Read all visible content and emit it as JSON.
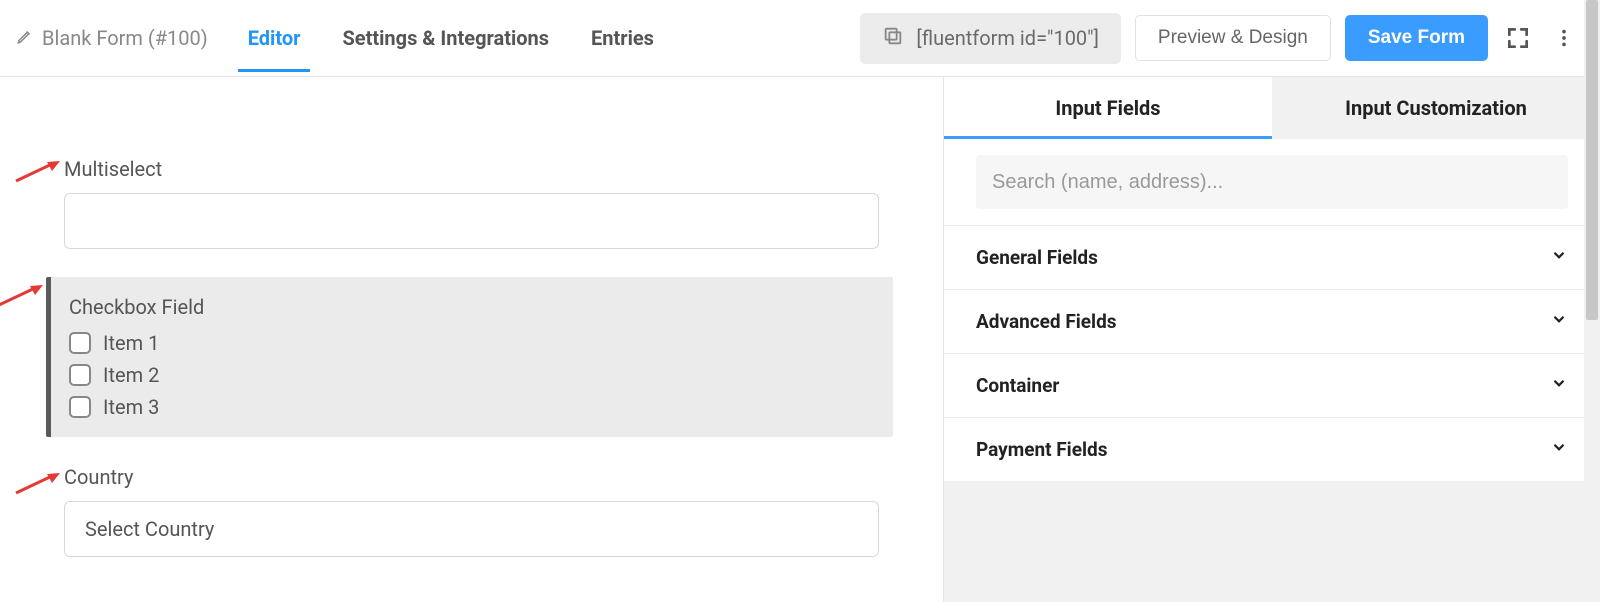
{
  "header": {
    "form_title": "Blank Form (#100)",
    "tabs": {
      "editor": "Editor",
      "settings": "Settings & Integrations",
      "entries": "Entries"
    },
    "shortcode": "[fluentform id=\"100\"]",
    "preview_label": "Preview & Design",
    "save_label": "Save Form"
  },
  "canvas": {
    "fields": [
      {
        "type": "multiselect",
        "label": "Multiselect",
        "value": ""
      },
      {
        "type": "checkbox",
        "label": "Checkbox Field",
        "items": [
          "Item 1",
          "Item 2",
          "Item 3"
        ]
      },
      {
        "type": "country",
        "label": "Country",
        "placeholder": "Select Country"
      }
    ]
  },
  "sidebar": {
    "tabs": {
      "fields": "Input Fields",
      "custom": "Input Customization"
    },
    "search_placeholder": "Search (name, address)...",
    "panels": [
      "General Fields",
      "Advanced Fields",
      "Container",
      "Payment Fields"
    ]
  }
}
